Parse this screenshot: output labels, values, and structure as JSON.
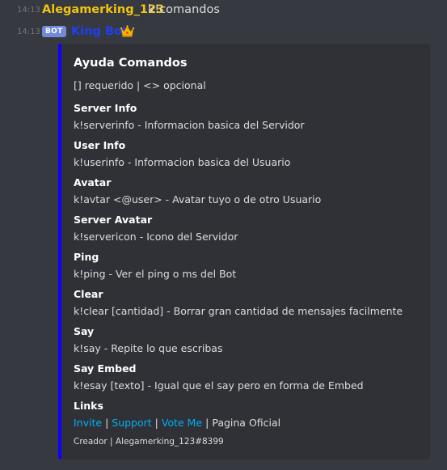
{
  "messages": [
    {
      "timestamp": "14:13",
      "author": "Alegamerking_123",
      "content": "k!comandos"
    },
    {
      "timestamp": "14:13",
      "bot_tag": "BOT",
      "author": "King Bot",
      "author_icon": "crown-icon"
    }
  ],
  "colors": {
    "background": "#36393f",
    "embed_bg": "#2f3136",
    "embed_accent": "#0d00ff",
    "user_name": "#f1c40f",
    "bot_name": "#1e3ff5",
    "link": "#00b0f4",
    "bot_tag": "#7289da"
  },
  "embed": {
    "title": "Ayuda Comandos",
    "description": "[] requerido | <> opcional",
    "fields": [
      {
        "name": "Server Info",
        "value": "k!serverinfo - Informacion basica del Servidor"
      },
      {
        "name": "User Info",
        "value": "k!userinfo - Informacion basica del Usuario"
      },
      {
        "name": "Avatar",
        "value": "k!avtar <@user> - Avatar tuyo o de otro Usuario"
      },
      {
        "name": "Server Avatar",
        "value": "k!servericon - Icono del Servidor"
      },
      {
        "name": "Ping",
        "value": "k!ping - Ver el ping o ms del Bot"
      },
      {
        "name": "Clear",
        "value": "k!clear [cantidad] - Borrar gran cantidad de mensajes facilmente"
      },
      {
        "name": "Say",
        "value": "k!say - Repite lo que escribas"
      },
      {
        "name": "Say Embed",
        "value": "k!esay [texto] - Igual que el say pero en forma de Embed"
      }
    ],
    "links": {
      "name": "Links",
      "items": [
        "Invite",
        "Support",
        "Vote Me"
      ],
      "separator": "|",
      "trailing_text": "Pagina Oficial"
    },
    "footer": "Creador | Alegamerking_123#8399"
  }
}
